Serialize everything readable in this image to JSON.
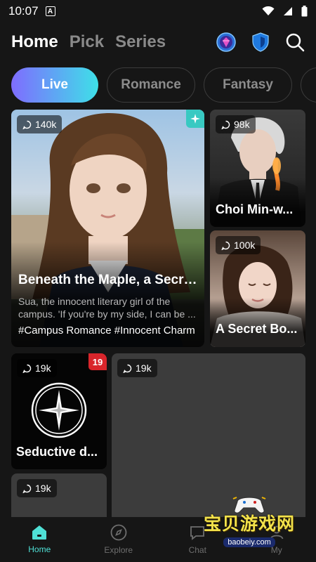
{
  "status_bar": {
    "time": "10:07",
    "a_icon_letter": "A"
  },
  "header": {
    "tabs": [
      {
        "label": "Home",
        "active": true
      },
      {
        "label": "Pick",
        "active": false
      },
      {
        "label": "Series",
        "active": false
      }
    ]
  },
  "chips": [
    {
      "label": "Live",
      "active": true
    },
    {
      "label": "Romance",
      "active": false
    },
    {
      "label": "Fantasy",
      "active": false
    }
  ],
  "cards": {
    "maple": {
      "count": "140k",
      "title": "Beneath the Maple, a Secre...",
      "description": "Sua, the innocent literary girl of the campus. 'If you're by my side, I can be ...",
      "tags": "#Campus Romance #Innocent Charm"
    },
    "choi": {
      "count": "98k",
      "title": "Choi Min-w..."
    },
    "secret": {
      "count": "100k",
      "title": "A Secret Bo..."
    },
    "seductive": {
      "count": "19k",
      "title": "Seductive d...",
      "age_badge": "19"
    },
    "empty_large": {
      "count": "19k"
    },
    "empty_small": {
      "count": "19k"
    }
  },
  "bottom_nav": [
    {
      "label": "Home",
      "icon": "home-icon",
      "active": true
    },
    {
      "label": "Explore",
      "icon": "compass-icon",
      "active": false
    },
    {
      "label": "Chat",
      "icon": "chat-icon",
      "active": false
    },
    {
      "label": "My",
      "icon": "user-icon",
      "active": false
    }
  ],
  "watermark": {
    "big": "宝贝游戏网",
    "small": "baobeiy.com"
  },
  "colors": {
    "accent": "#4fe0d6",
    "chip_gradient_start": "#7f6cff",
    "chip_gradient_end": "#3ee0e8",
    "age_badge": "#d9252b"
  }
}
